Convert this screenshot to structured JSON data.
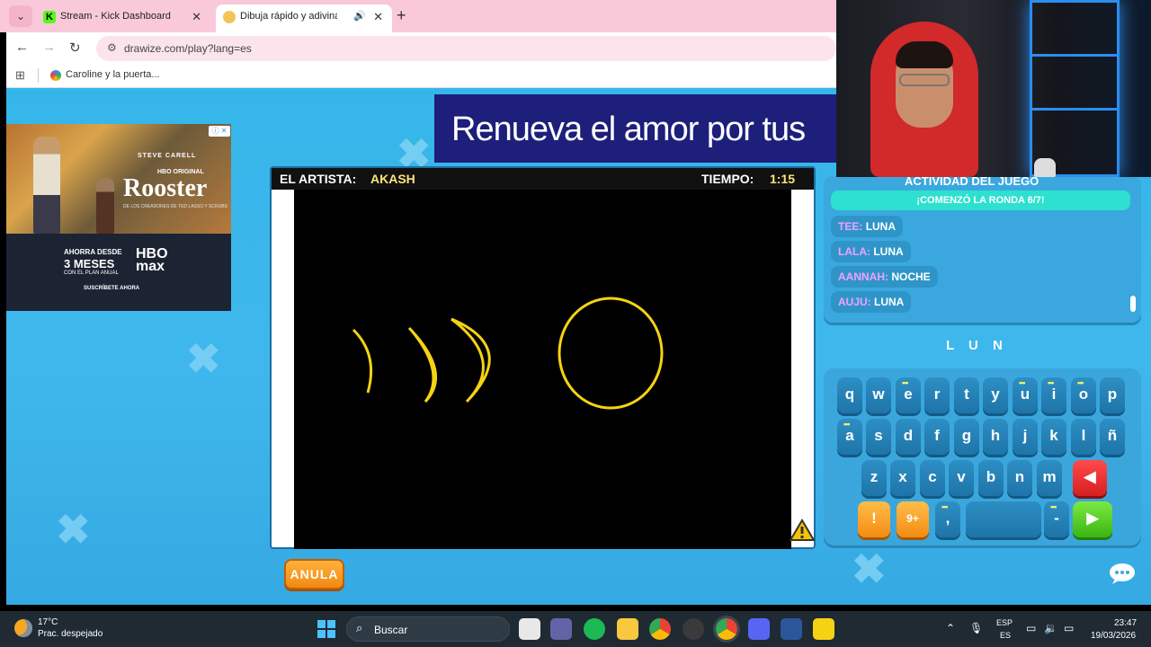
{
  "browser": {
    "tabs": [
      {
        "title": "Stream - Kick Dashboard",
        "favicon": "kick-logo-icon"
      },
      {
        "title": "Dibuja rápido y adivina",
        "favicon": "drawize-logo-icon"
      }
    ],
    "url": "drawize.com/play?lang=es",
    "bookmark": "Caroline y la puerta...",
    "accent": "#f9c9da"
  },
  "ad_banner": {
    "text": "Renueva el amor por tus"
  },
  "side_ad": {
    "actor": "STEVE CARELL",
    "brand_small": "HBO ORIGINAL",
    "show": "Rooster",
    "blurb": "DE LOS CREADORES DE TED LASSO Y SCRUBS",
    "offer_line1": "AHORRA DESDE",
    "offer_line2": "3 MESES",
    "offer_line3": "CON EL PLAN ANUAL",
    "brand": "HBO max",
    "cta": "SUSCRÍBETE AHORA"
  },
  "game": {
    "artist_label": "EL ARTISTA:",
    "artist_name": "AKASH",
    "time_label": "TIEMPO:",
    "time_value": "1:15",
    "cancel_button": "ANULA",
    "answer_hint": "L U N"
  },
  "activity": {
    "title": "ACTIVIDAD DEL JUEGO",
    "round": "¡COMENZÓ LA RONDA 6/7!",
    "guesses": [
      {
        "who": "TEE:",
        "word": "LUNA"
      },
      {
        "who": "LALA:",
        "word": "LUNA"
      },
      {
        "who": "AANNAH:",
        "word": "NOCHE"
      },
      {
        "who": "AUJU:",
        "word": "LUNA"
      }
    ]
  },
  "keyboard": {
    "row1": [
      "q",
      "w",
      "e",
      "r",
      "t",
      "y",
      "u",
      "i",
      "o",
      "p"
    ],
    "row2": [
      "a",
      "s",
      "d",
      "f",
      "g",
      "h",
      "j",
      "k",
      "l",
      "ñ"
    ],
    "row3": [
      "z",
      "x",
      "c",
      "v",
      "b",
      "n",
      "m"
    ],
    "row4_hint": "!",
    "row4_hint2": "9+",
    "row4_comma": ",",
    "row4_dash": "-",
    "dotted_keys": [
      "e",
      "u",
      "i",
      "o",
      "a"
    ]
  },
  "taskbar": {
    "temperature": "17°C",
    "weather": "Prac. despejado",
    "search": "Buscar",
    "lang_top": "ESP",
    "lang_bottom": "ES",
    "time": "23:47",
    "date": "19/03/2026"
  }
}
